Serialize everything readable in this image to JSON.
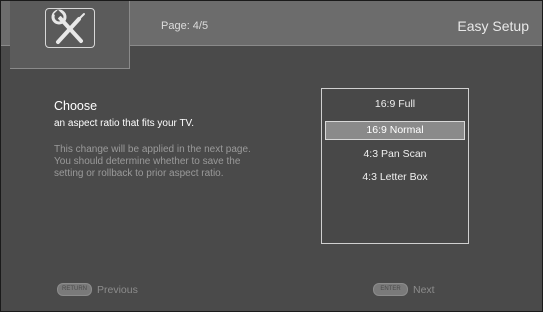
{
  "header": {
    "page_label": "Page: 4/5",
    "title": "Easy Setup",
    "logo_icon": "wrench-screwdriver-icon"
  },
  "main": {
    "heading": "Choose",
    "subtitle": "an aspect ratio that fits your TV.",
    "description_lines": [
      "This change will be applied in the next page.",
      "You should determine whether to save the",
      "setting or rollback to prior aspect ratio."
    ]
  },
  "options": {
    "items": [
      "16:9 Full",
      "16:9 Normal",
      "4:3 Pan Scan",
      "4:3 Letter Box"
    ],
    "selected": "16:9 Normal"
  },
  "footer": {
    "previous_key": "RETURN",
    "previous_label": "Previous",
    "next_key": "ENTER",
    "next_label": "Next"
  }
}
